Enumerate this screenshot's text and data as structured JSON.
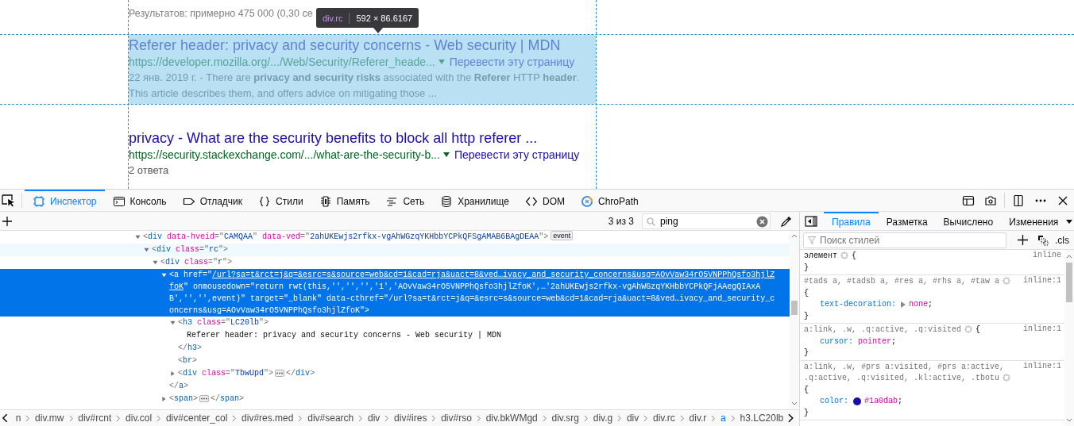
{
  "page": {
    "stats": "Результатов: примерно 475 000 (0,30 се",
    "results": [
      {
        "title": "Referer header: privacy and security concerns - Web security | MDN",
        "url": "https://developer.mozilla.org/.../Web/Security/Referer_heade...",
        "translate": "Перевести эту страницу",
        "snippet": "22 янв. 2019 г. - There are **privacy and security risks** associated with the **Referer** HTTP **header**.\nThis article describes them, and offers advice on mitigating those ...",
        "highlighted": true
      },
      {
        "title": "privacy - What are the security benefits to block all http referer ...",
        "url": "https://security.stackexchange.com/.../what-are-the-security-b...",
        "translate": "Перевести эту страницу",
        "snippet": "2 ответа",
        "highlighted": false
      }
    ],
    "tooltip": {
      "selector": "div.rc",
      "size": "592 × 86.6167"
    }
  },
  "toolbar": {
    "tabs": [
      {
        "label": "Инспектор",
        "selected": true
      },
      {
        "label": "Консоль",
        "selected": false
      },
      {
        "label": "Отладчик",
        "selected": false
      },
      {
        "label": "Стили",
        "selected": false
      },
      {
        "label": "Память",
        "selected": false
      },
      {
        "label": "Сеть",
        "selected": false
      },
      {
        "label": "Хранилище",
        "selected": false
      },
      {
        "label": "DOM",
        "selected": false
      },
      {
        "label": "ChroPath",
        "selected": false
      }
    ]
  },
  "markup": {
    "search": {
      "matches": "3 из 3",
      "value": "ping"
    },
    "nodes": [
      {
        "kind": "element",
        "expanded": true,
        "selected": false,
        "hovered": false,
        "badge": "event",
        "tokens": [
          {
            "kind": "p",
            "text": "<"
          },
          {
            "kind": "tag",
            "text": "div"
          },
          {
            "kind": "attr",
            "text": " data-hveid"
          },
          {
            "kind": "p",
            "text": "=\""
          },
          {
            "kind": "val",
            "text": "CAMQAA"
          },
          {
            "kind": "p",
            "text": "\""
          },
          {
            "kind": "attr",
            "text": " data-ved"
          },
          {
            "kind": "p",
            "text": "=\""
          },
          {
            "kind": "val",
            "text": "2ahUKEwjs2rfkx-vgAhWGzqYKHbbYCPkQFSgAMAB6BAgDEAA"
          },
          {
            "kind": "p",
            "text": "\">"
          }
        ],
        "children": [
          {
            "kind": "element",
            "expanded": true,
            "selected": false,
            "hovered": true,
            "tokens": [
              {
                "kind": "p",
                "text": "<"
              },
              {
                "kind": "tag",
                "text": "div"
              },
              {
                "kind": "attr",
                "text": " class"
              },
              {
                "kind": "p",
                "text": "=\""
              },
              {
                "kind": "val",
                "text": "rc"
              },
              {
                "kind": "p",
                "text": "\">"
              }
            ],
            "children": [
              {
                "kind": "element",
                "expanded": true,
                "selected": false,
                "hovered": false,
                "tokens": [
                  {
                    "kind": "p",
                    "text": "<"
                  },
                  {
                    "kind": "tag",
                    "text": "div"
                  },
                  {
                    "kind": "attr",
                    "text": " class"
                  },
                  {
                    "kind": "p",
                    "text": "=\""
                  },
                  {
                    "kind": "val",
                    "text": "r"
                  },
                  {
                    "kind": "p",
                    "text": "\">"
                  }
                ],
                "children": [
                  {
                    "kind": "element",
                    "expanded": true,
                    "selected": true,
                    "tokens": [
                      {
                        "kind": "p",
                        "text": "<"
                      },
                      {
                        "kind": "tag",
                        "text": "a"
                      },
                      {
                        "kind": "attr",
                        "text": " href"
                      },
                      {
                        "kind": "p",
                        "text": "=\""
                      },
                      {
                        "kind": "link",
                        "text": "/url?sa=t&rct=j&q=&esrc=s&source=web&cd=1&cad=rja&uact=8&ved…ivacy_and_security_concerns&usg=AOvVaw34rO5VNPPhQsfo3hjlZfoK"
                      },
                      {
                        "kind": "p",
                        "text": "\""
                      },
                      {
                        "kind": "attr",
                        "text": " onmousedown"
                      },
                      {
                        "kind": "p",
                        "text": "=\""
                      },
                      {
                        "kind": "val",
                        "text": "return rwt(this,'','','','1','AOvVaw34rO5VNPPhQsfo3hjlZfoK',…'2ahUKEwjs2rfkx-vgAhWGzqYKHbbYCPkQFjAAegQIAxAB','','',event)"
                      },
                      {
                        "kind": "p",
                        "text": "\""
                      },
                      {
                        "kind": "attr",
                        "text": " target"
                      },
                      {
                        "kind": "p",
                        "text": "=\""
                      },
                      {
                        "kind": "val",
                        "text": "_blank"
                      },
                      {
                        "kind": "p",
                        "text": "\""
                      },
                      {
                        "kind": "attr",
                        "text": " data-cthref"
                      },
                      {
                        "kind": "p",
                        "text": "=\""
                      },
                      {
                        "kind": "val",
                        "text": "/url?sa=t&rct=j&q=&esrc=s&source=web&cd=1&cad=rja&uact=8&ved…ivacy_and_security_concerns&usg=AOvVaw34rO5VNPPhQsfo3hjlZfoK"
                      },
                      {
                        "kind": "p",
                        "text": "\">"
                      }
                    ],
                    "children": [
                      {
                        "kind": "element",
                        "expanded": true,
                        "selected": false,
                        "hovered": false,
                        "tokens": [
                          {
                            "kind": "p",
                            "text": "<"
                          },
                          {
                            "kind": "tag",
                            "text": "h3"
                          },
                          {
                            "kind": "attr",
                            "text": " class"
                          },
                          {
                            "kind": "p",
                            "text": "=\""
                          },
                          {
                            "kind": "val",
                            "text": "LC20lb"
                          },
                          {
                            "kind": "p",
                            "text": "\">"
                          }
                        ],
                        "children": [
                          {
                            "kind": "text",
                            "text": "Referer header: privacy and security concerns - Web security | MDN"
                          }
                        ],
                        "close": [
                          {
                            "kind": "p",
                            "text": "</"
                          },
                          {
                            "kind": "tag",
                            "text": "h3"
                          },
                          {
                            "kind": "p",
                            "text": ">"
                          }
                        ]
                      },
                      {
                        "kind": "element",
                        "selected": false,
                        "hovered": false,
                        "tokens": [
                          {
                            "kind": "p",
                            "text": "<"
                          },
                          {
                            "kind": "tag",
                            "text": "br"
                          },
                          {
                            "kind": "p",
                            "text": ">"
                          }
                        ]
                      },
                      {
                        "kind": "element",
                        "expanded": false,
                        "selected": false,
                        "hovered": false,
                        "tokens": [
                          {
                            "kind": "p",
                            "text": "<"
                          },
                          {
                            "kind": "tag",
                            "text": "div"
                          },
                          {
                            "kind": "attr",
                            "text": " class"
                          },
                          {
                            "kind": "p",
                            "text": "=\""
                          },
                          {
                            "kind": "val",
                            "text": "TbwUpd"
                          },
                          {
                            "kind": "p",
                            "text": "\">"
                          }
                        ],
                        "close": [
                          {
                            "kind": "p",
                            "text": "</"
                          },
                          {
                            "kind": "tag",
                            "text": "div"
                          },
                          {
                            "kind": "p",
                            "text": ">"
                          }
                        ]
                      }
                    ],
                    "close": [
                      {
                        "kind": "p",
                        "text": "</"
                      },
                      {
                        "kind": "tag",
                        "text": "a"
                      },
                      {
                        "kind": "p",
                        "text": ">"
                      }
                    ]
                  },
                  {
                    "kind": "element",
                    "expanded": false,
                    "selected": false,
                    "hovered": false,
                    "tokens": [
                      {
                        "kind": "p",
                        "text": "<"
                      },
                      {
                        "kind": "tag",
                        "text": "span"
                      },
                      {
                        "kind": "p",
                        "text": ">"
                      }
                    ],
                    "close": [
                      {
                        "kind": "p",
                        "text": "</"
                      },
                      {
                        "kind": "tag",
                        "text": "span"
                      },
                      {
                        "kind": "p",
                        "text": ">"
                      }
                    ]
                  }
                ]
              }
            ]
          }
        ]
      }
    ]
  },
  "breadcrumbs": [
    {
      "label": "n",
      "selected": false
    },
    {
      "label": "div.mw",
      "selected": false
    },
    {
      "label": "div#rcnt",
      "selected": false
    },
    {
      "label": "div.col",
      "selected": false
    },
    {
      "label": "div#center_col",
      "selected": false
    },
    {
      "label": "div#res.med",
      "selected": false
    },
    {
      "label": "div#search",
      "selected": false
    },
    {
      "label": "div",
      "selected": false
    },
    {
      "label": "div#ires",
      "selected": false
    },
    {
      "label": "div#rso",
      "selected": false
    },
    {
      "label": "div.bkWMgd",
      "selected": false
    },
    {
      "label": "div.srg",
      "selected": false
    },
    {
      "label": "div.g",
      "selected": false
    },
    {
      "label": "div",
      "selected": false
    },
    {
      "label": "div.rc",
      "selected": false
    },
    {
      "label": "div.r",
      "selected": false
    },
    {
      "label": "a",
      "selected": true
    },
    {
      "label": "h3.LC20lb",
      "selected": false
    }
  ],
  "rules_pane": {
    "tabs": [
      {
        "label": "Правила",
        "selected": true
      },
      {
        "label": "Разметка",
        "selected": false
      },
      {
        "label": "Вычислено",
        "selected": false
      },
      {
        "label": "Изменения",
        "selected": false
      }
    ],
    "filter_placeholder": "Поиск стилей",
    "cls_label": ".cls",
    "rules": [
      {
        "kind": "element",
        "selector": "элемент",
        "source": "inline",
        "open": "{",
        "close": "}"
      },
      {
        "kind": "rule",
        "selector": "#tads a, #tadsb a, #res a, #rhs a, #taw a",
        "source": "inline:1",
        "open_line": "{",
        "close": "}",
        "declarations": [
          {
            "kind": "expandable",
            "name": "text-decoration:",
            "value": "none",
            "end": ";"
          }
        ]
      },
      {
        "kind": "rule",
        "selector": "a:link, .w, .q:active, .q:visited",
        "source": "inline:1",
        "open": "{",
        "close": "}",
        "declarations": [
          {
            "kind": "plain",
            "name": "cursor:",
            "value": "pointer",
            "end": ";"
          }
        ]
      },
      {
        "kind": "rule",
        "selector": "a:link, .w, #prs a:visited, #prs a:active, .q:active, .q:visited, .kl:active, .tbotu",
        "source": "inline:1",
        "open_line": "{",
        "close": "}",
        "declarations": [
          {
            "kind": "color",
            "name": "color:",
            "value": "#1a0dab",
            "end": ";"
          }
        ]
      }
    ]
  }
}
